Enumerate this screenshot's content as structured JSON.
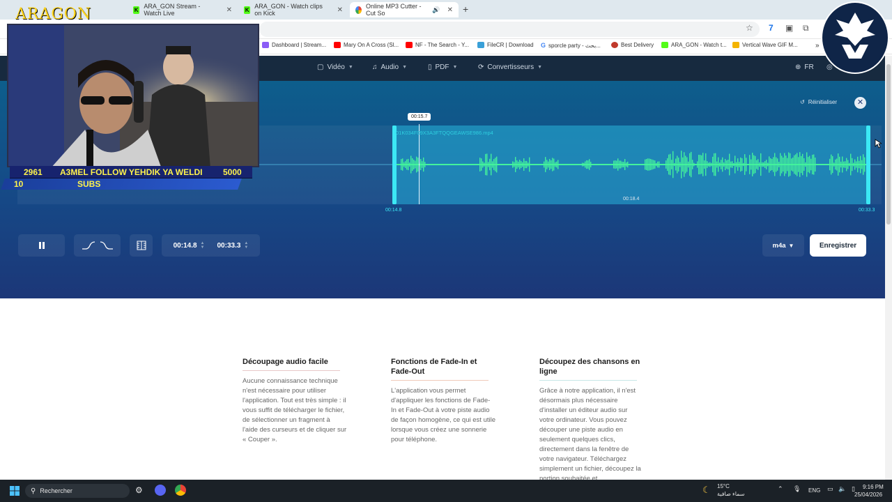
{
  "browser": {
    "tabs": [
      {
        "title": "ARA_GON Stream - Watch Live",
        "favicon": "kick-icon"
      },
      {
        "title": "ARA_GON - Watch clips on Kick",
        "favicon": "kick-icon"
      },
      {
        "title": "Online MP3 Cutter - Cut So",
        "favicon": "cutter-icon"
      }
    ],
    "bookmarks": [
      "Dashboard | Stream...",
      "Mary On A Cross (Sl...",
      "NF - The Search - Y...",
      "FileCR | Download",
      "sporcle party - بحث...",
      "Best Delivery",
      "ARA_GON - Watch t...",
      "Vertical Wave GIF M..."
    ],
    "bookmarks_more": "»"
  },
  "site_nav": {
    "items": [
      {
        "label": "Vidéo",
        "icon": "video-icon"
      },
      {
        "label": "Audio",
        "icon": "music-icon"
      },
      {
        "label": "PDF",
        "icon": "pdf-icon"
      },
      {
        "label": "Convertisseurs",
        "icon": "convert-icon"
      }
    ],
    "language": "FR"
  },
  "editor": {
    "reset_label": "Réinitialiser",
    "filename": "01K034F09X3A3FTQQGEAWSE986.mp4",
    "playhead_time": "00:15.7",
    "start_time": "00:14.8",
    "end_time": "00:33.3",
    "mid_time": "00:18.4",
    "controls": {
      "start_value": "00:14.8",
      "end_value": "00:33.3",
      "format": "m4a",
      "save_label": "Enregistrer"
    },
    "colors": {
      "accent": "#3ce8f5",
      "wave": "#43f29c",
      "bg": "#164886"
    }
  },
  "features": [
    {
      "title": "Découpage audio facile",
      "text": "Aucune connaissance technique n'est nécessaire pour utiliser l'application. Tout est très simple : il vous suffit de télécharger le fichier, de sélectionner un fragment à l'aide des curseurs et de cliquer sur « Couper ».",
      "underline": "#e8c7c7"
    },
    {
      "title": "Fonctions de Fade-In et Fade-Out",
      "text": "L'application vous permet d'appliquer les fonctions de Fade-In et Fade-Out à votre piste audio de façon homogène, ce qui est utile lorsque vous créez une sonnerie pour téléphone.",
      "underline": "#efc9b9"
    },
    {
      "title": "Découpez des chansons en ligne",
      "text": "Grâce à notre application, il n'est désormais plus nécessaire d'installer un éditeur audio sur votre ordinateur. Vous pouvez découper une piste audio en seulement quelques clics, directement dans la fenêtre de votre navigateur. Téléchargez simplement un fichier, découpez la portion souhaitée et",
      "underline": "#c7e6e6"
    }
  ],
  "overlay": {
    "channel": "ARAGON",
    "row1": {
      "left": "2961",
      "text": "A3MEL FOLLOW YEHDIK YA WELDI",
      "right": "5000"
    },
    "row2": {
      "left": "10",
      "text": "SUBS"
    }
  },
  "taskbar": {
    "search": "Rechercher",
    "weather_temp": "15°C",
    "weather_desc": "سماء صافية",
    "lang": "ENG",
    "time": "9:16 PM",
    "date": "25/04/2026"
  }
}
